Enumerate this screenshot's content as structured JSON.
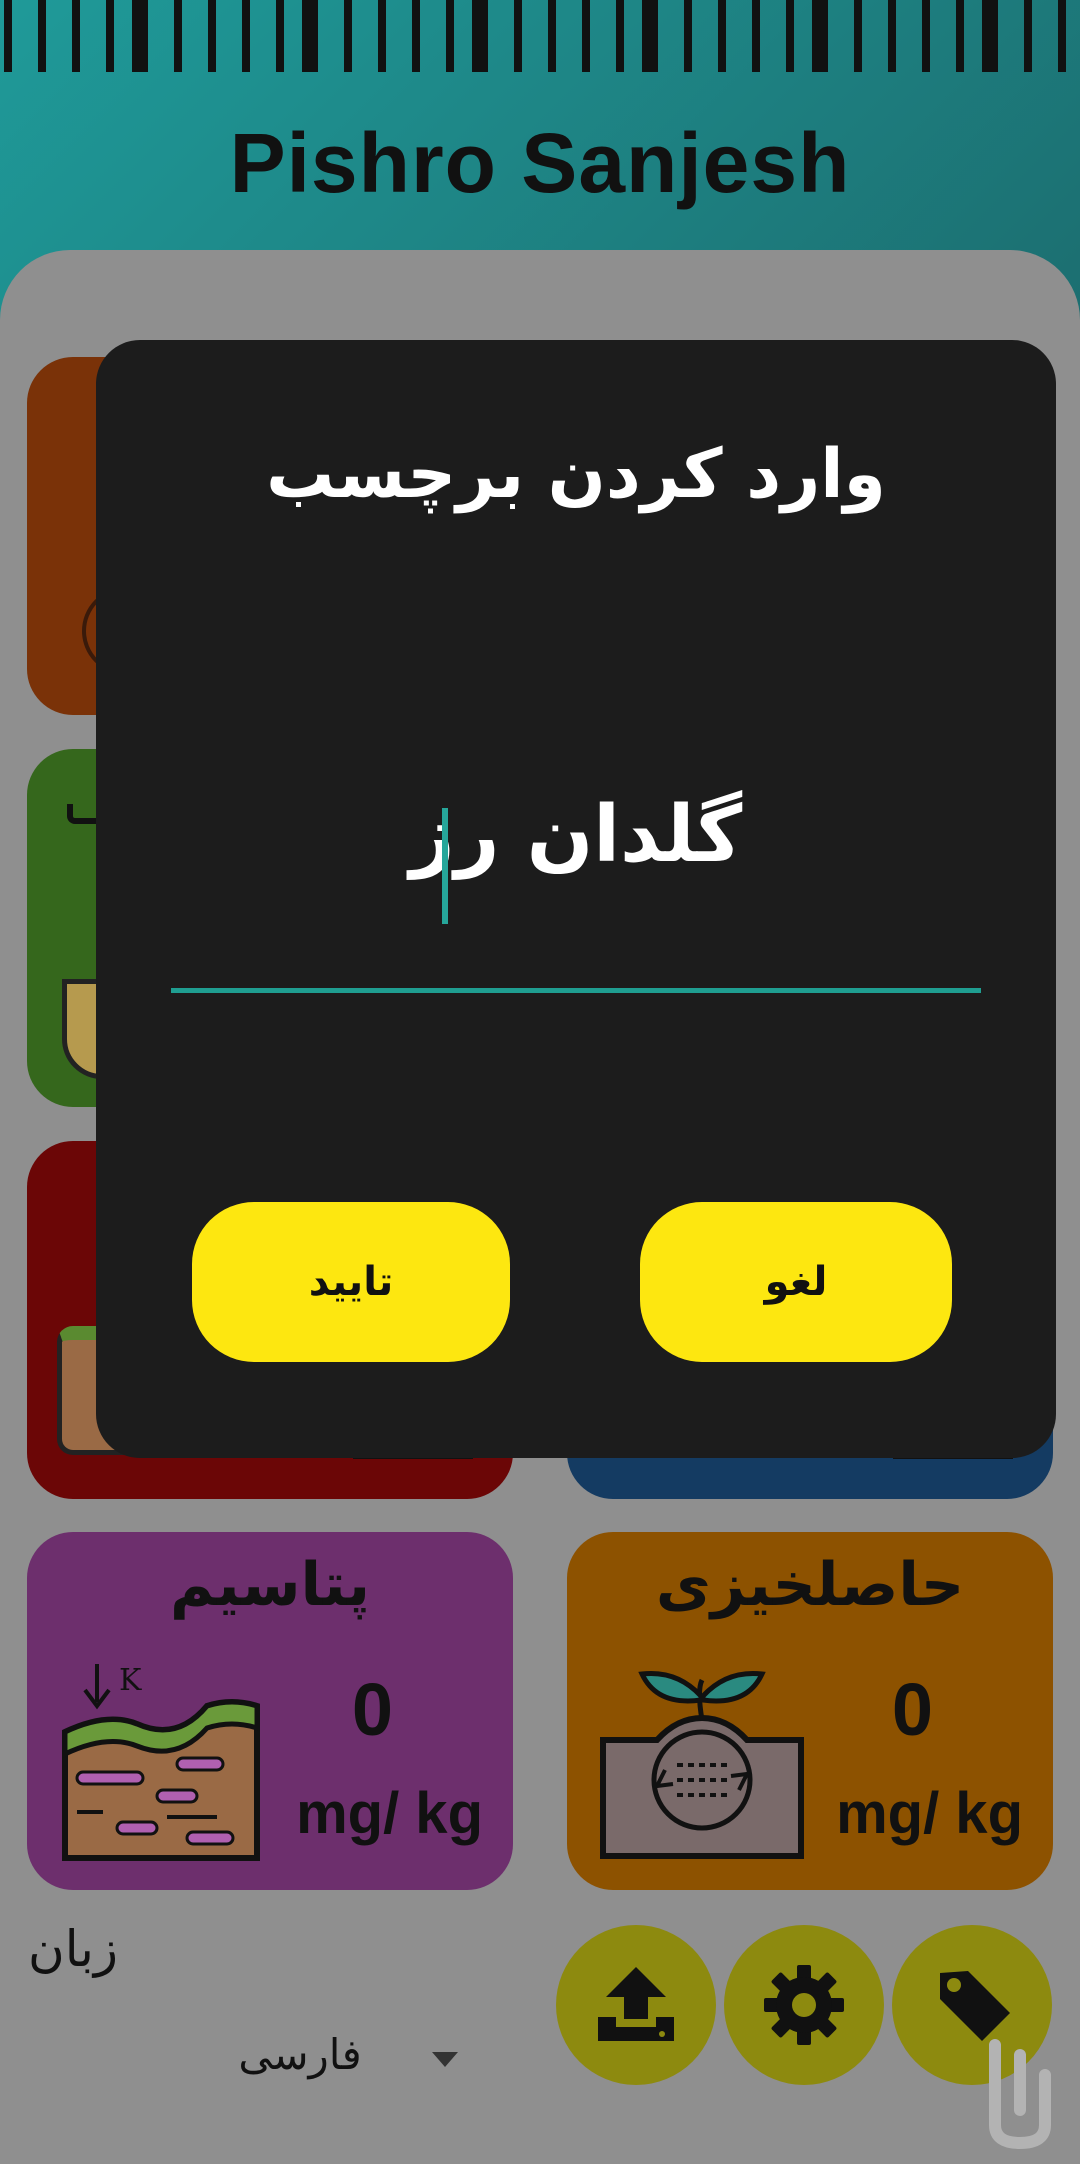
{
  "app": {
    "title": "Pishro Sanjesh"
  },
  "cards": {
    "potassium": {
      "title": "پتاسیم",
      "value": "0",
      "unit": "mg/ kg",
      "color": "#6d2f6d"
    },
    "fertility": {
      "title": "حاصلخیزی",
      "value": "0",
      "unit": "mg/ kg",
      "color": "#8d5200"
    },
    "background_colors": {
      "orange": "#7a3208",
      "green": "#35671c",
      "red": "#6b0606",
      "blue": "#143b62"
    }
  },
  "language": {
    "label": "زبان",
    "selected": "فارسی"
  },
  "toolbar": {
    "icons": [
      "upload-icon",
      "gear-icon",
      "tag-icon"
    ],
    "button_color": "#8d8a0f"
  },
  "dialog": {
    "title": "وارد کردن برچسب",
    "input_value": "گلدان رز",
    "confirm_label": "تایید",
    "cancel_label": "لغو",
    "accent_color": "#1f9e91",
    "button_color": "#fde710"
  }
}
